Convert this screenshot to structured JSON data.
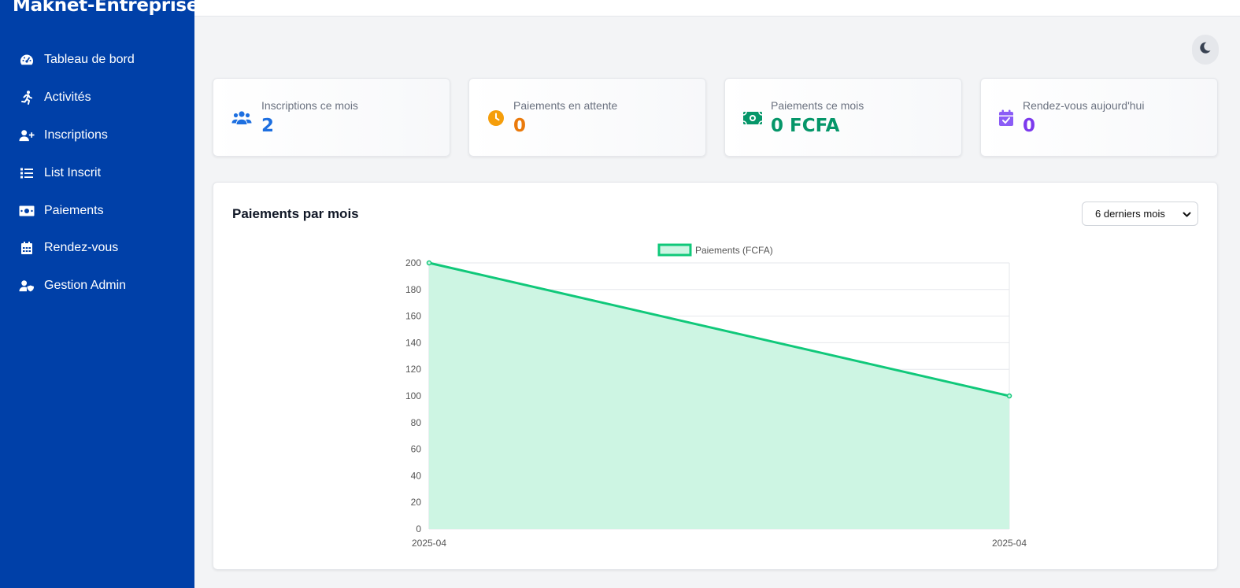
{
  "app": {
    "brand": "Maknet-Entreprise"
  },
  "sidebar": {
    "items": [
      {
        "label": "Tableau de bord",
        "icon": "dashboard-icon"
      },
      {
        "label": "Activités",
        "icon": "running-icon"
      },
      {
        "label": "Inscriptions",
        "icon": "user-plus-icon"
      },
      {
        "label": "List Inscrit",
        "icon": "list-icon"
      },
      {
        "label": "Paiements",
        "icon": "money-icon"
      },
      {
        "label": "Rendez-vous",
        "icon": "calendar-icon"
      },
      {
        "label": "Gestion Admin",
        "icon": "user-shield-icon"
      }
    ]
  },
  "header": {
    "theme_toggle_icon": "moon-icon"
  },
  "stats": [
    {
      "label": "Inscriptions ce mois",
      "value": "2",
      "icon": "users-icon",
      "color": "#1d6fe0"
    },
    {
      "label": "Paiements en attente",
      "value": "0",
      "icon": "clock-icon",
      "color": "#ea7a0b"
    },
    {
      "label": "Paiements ce mois",
      "value": "0 FCFA",
      "icon": "money-icon",
      "color": "#059669"
    },
    {
      "label": "Rendez-vous aujourd'hui",
      "value": "0",
      "icon": "calendar-check-icon",
      "color": "#7c3aed"
    }
  ],
  "chart_panel": {
    "title": "Paiements par mois",
    "period_select": {
      "selected": "6 derniers mois"
    }
  },
  "chart_data": {
    "type": "area",
    "x": [
      "2025-04",
      "2025-04"
    ],
    "series": [
      {
        "name": "Paiements (FCFA)",
        "values": [
          200,
          100
        ],
        "color": "#10c87a",
        "fill": "#cdf5e3"
      }
    ],
    "ylim": [
      0,
      200
    ],
    "yticks": [
      0,
      20,
      40,
      60,
      80,
      100,
      120,
      140,
      160,
      180,
      200
    ],
    "legend_position": "top",
    "grid": true
  }
}
